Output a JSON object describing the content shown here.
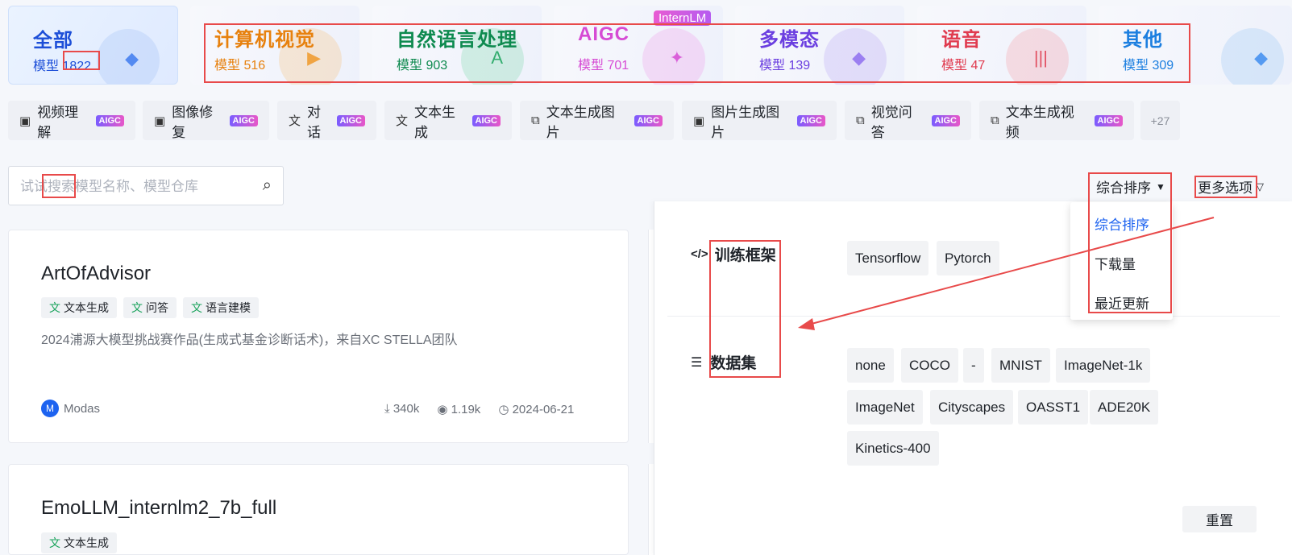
{
  "categories": [
    {
      "title": "全部",
      "count_label": "模型",
      "count": "1822",
      "color": "#1d4fd8",
      "active": true
    },
    {
      "title": "计算机视觉",
      "count_label": "模型",
      "count": "516",
      "color": "#e7810e"
    },
    {
      "title": "自然语言处理",
      "count_label": "模型",
      "count": "903",
      "color": "#0e8a4f"
    },
    {
      "title": "AIGC",
      "count_label": "模型",
      "count": "701",
      "color": "#d64bd4"
    },
    {
      "title": "多模态",
      "count_label": "模型",
      "count": "139",
      "color": "#6b3fe0"
    },
    {
      "title": "语音",
      "count_label": "模型",
      "count": "47",
      "color": "#e03b4f"
    },
    {
      "title": "其他",
      "count_label": "模型",
      "count": "309",
      "color": "#1c7fe0"
    }
  ],
  "internlm_badge": "InternLM",
  "tags": [
    {
      "label": "视频理解",
      "icon": "image-icon",
      "badge": "AIGC"
    },
    {
      "label": "图像修复",
      "icon": "image-icon",
      "badge": "AIGC"
    },
    {
      "label": "对话",
      "icon": "translate-icon",
      "badge": "AIGC"
    },
    {
      "label": "文本生成",
      "icon": "translate-icon",
      "badge": "AIGC"
    },
    {
      "label": "文本生成图片",
      "icon": "multimodal-icon",
      "badge": "AIGC"
    },
    {
      "label": "图片生成图片",
      "icon": "image-icon",
      "badge": "AIGC"
    },
    {
      "label": "视觉问答",
      "icon": "multimodal-icon",
      "badge": "AIGC"
    },
    {
      "label": "文本生成视频",
      "icon": "multimodal-icon",
      "badge": "AIGC"
    }
  ],
  "more_tags": "+27",
  "search": {
    "placeholder": "试试搜索模型名称、模型仓库"
  },
  "sort": {
    "label": "综合排序",
    "more_options": "更多选项",
    "options": [
      "综合排序",
      "下载量",
      "最近更新"
    ],
    "selected": "综合排序"
  },
  "filters": {
    "framework_title": "训练框架",
    "frameworks": [
      "Tensorflow",
      "Pytorch"
    ],
    "dataset_title": "数据集",
    "datasets": [
      "none",
      "COCO",
      "-",
      "MNIST",
      "ImageNet-1k",
      "ImageNet",
      "Cityscapes",
      "OASST1",
      "ADE20K",
      "Kinetics-400"
    ],
    "reset_label": "重置"
  },
  "models": [
    {
      "name": "ArtOfAdvisor",
      "tags": [
        "文本生成",
        "问答",
        "语言建模"
      ],
      "description": "2024浦源大模型挑战赛作品(生成式基金诊断话术)，来自XC STELLA团队",
      "author_initial": "M",
      "author": "Modas",
      "downloads": "340k",
      "views": "1.19k",
      "date": "2024-06-21"
    },
    {
      "name": "EmoLLM_internlm2_7b_full",
      "tags": [
        "文本生成"
      ]
    }
  ],
  "colors": {
    "accent": "#1d63f0",
    "annotation_red": "#e84a4a"
  }
}
